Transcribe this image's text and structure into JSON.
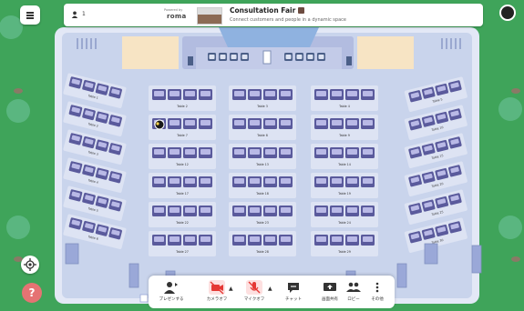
{
  "header": {
    "user_count": "1",
    "powered_by": "Powered by",
    "powered_logo": "roma",
    "thumb_caption": "Tabelle",
    "event_title": "Consultation Fair",
    "event_subtitle": "Connect customers and people in a dynamic space"
  },
  "room": {
    "left_tables": [
      "Table 1",
      "Table 2",
      "Table 3",
      "Table 4",
      "Table 5",
      "Table 6"
    ],
    "right_tables": [
      "Table 5",
      "Table 10",
      "Table 15",
      "Table 20",
      "Table 25",
      "Table 30"
    ],
    "middle_tables": [
      [
        "Table 2",
        "Table 3",
        "Table 4"
      ],
      [
        "Table 7",
        "Table 8",
        "Table 9"
      ],
      [
        "Table 12",
        "Table 13",
        "Table 14"
      ],
      [
        "Table 17",
        "Table 18",
        "Table 19"
      ],
      [
        "Table 22",
        "Table 23",
        "Table 24"
      ],
      [
        "Table 27",
        "Table 28",
        "Table 29"
      ]
    ]
  },
  "toolbar": {
    "present": "プレゼンする",
    "camera": "カメラオフ",
    "mic": "マイクオフ",
    "chat": "チャット",
    "screen_share": "画面共有",
    "lobby": "ロビー",
    "other": "その他"
  },
  "icons": {
    "menu": "menu-icon",
    "location": "location-target-icon",
    "help": "help-icon",
    "camera_off": "camera-off-icon",
    "mic_off": "mic-off-icon"
  },
  "colors": {
    "grass": "#3fa45a",
    "floor": "#c9d4ec",
    "chair": "#5a5a9c",
    "muted_red": "#e53935"
  }
}
